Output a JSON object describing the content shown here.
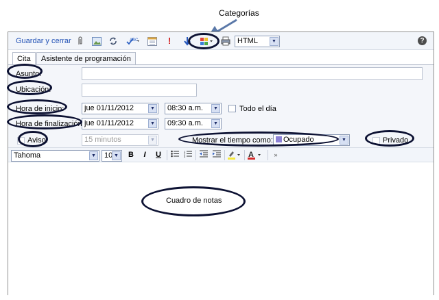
{
  "annotations": {
    "categorias": "Categorías",
    "cuadro_notas": "Cuadro de notas"
  },
  "toolbar": {
    "save_close": "Guardar y cerrar",
    "format_value": "HTML",
    "help_icon": "?"
  },
  "tabs": [
    {
      "label": "Cita",
      "active": true
    },
    {
      "label": "Asistente de programación",
      "active": false
    }
  ],
  "form": {
    "asunto_label": "Asunto:",
    "asunto_value": "",
    "ubicacion_label": "Ubicación:",
    "ubicacion_value": "",
    "inicio_label": "Hora de inicio:",
    "inicio_date": "jue 01/11/2012",
    "inicio_time": "08:30 a.m.",
    "todo_dia_label": "Todo el día",
    "fin_label": "Hora de finalización:",
    "fin_date": "jue 01/11/2012",
    "fin_time": "09:30 a.m.",
    "aviso_label": "Aviso:",
    "aviso_value": "15 minutos",
    "mostrar_label": "Mostrar el tiempo como:",
    "mostrar_value": "Ocupado",
    "privado_label": "Privado"
  },
  "format": {
    "font": "Tahoma",
    "size": "10",
    "bold": "B",
    "italic": "I",
    "underline": "U"
  },
  "colors": {
    "link": "#1f4fb4",
    "ellipse": "#0d1233",
    "busy": "#8d82d6",
    "font_color": "#d42a2a"
  }
}
